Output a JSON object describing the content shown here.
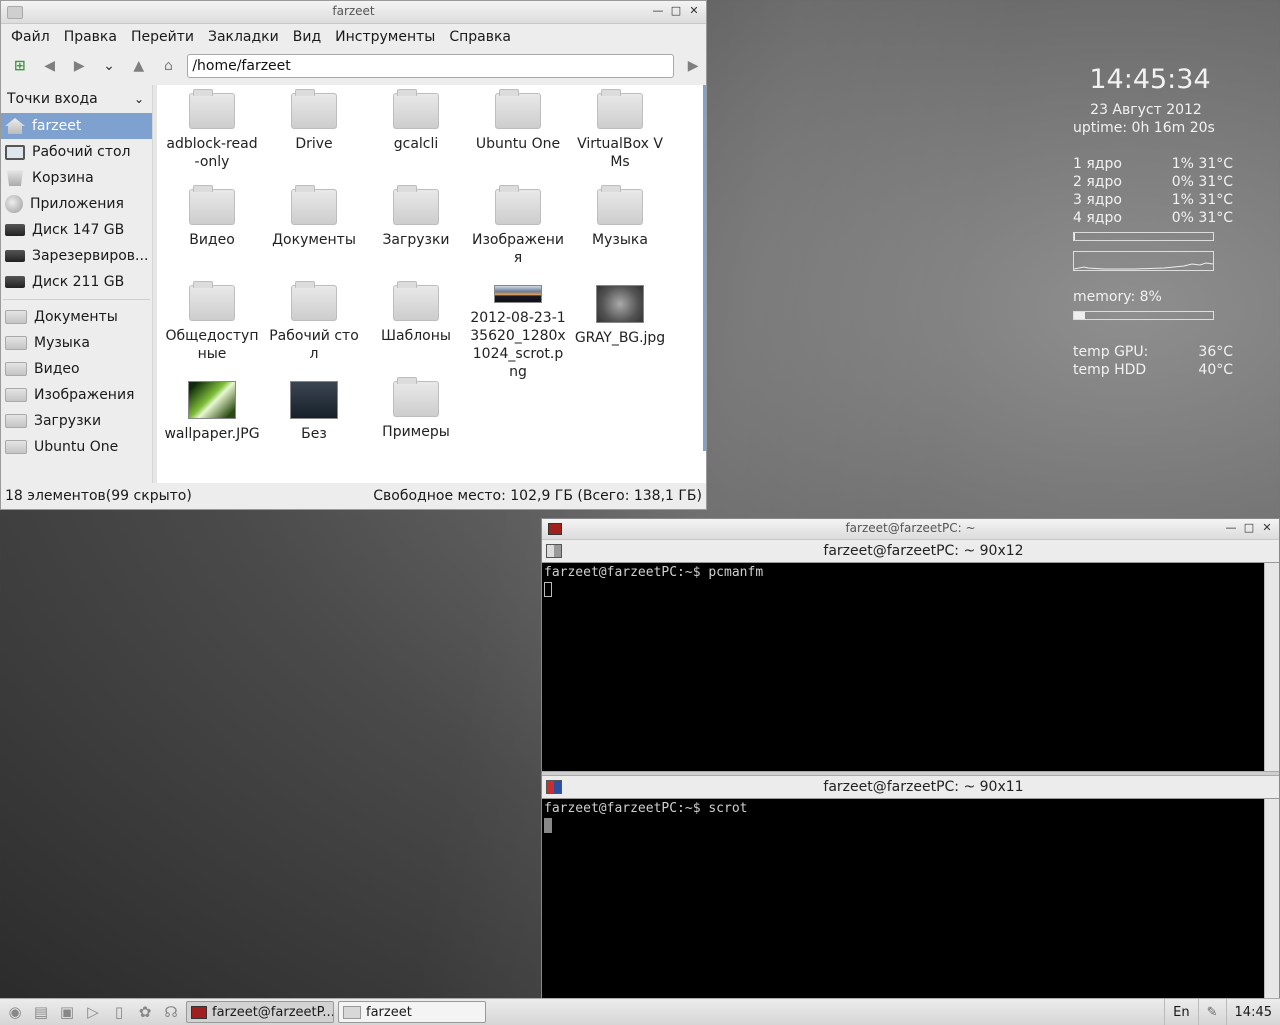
{
  "file_manager": {
    "window_title": "farzeet",
    "menu": [
      "Файл",
      "Правка",
      "Перейти",
      "Закладки",
      "Вид",
      "Инструменты",
      "Справка"
    ],
    "address": "/home/farzeet",
    "side_header": "Точки входа",
    "places": [
      {
        "label": "farzeet",
        "icon": "home-icon",
        "selected": true
      },
      {
        "label": "Рабочий стол",
        "icon": "monitor-icon"
      },
      {
        "label": "Корзина",
        "icon": "trash-icon"
      },
      {
        "label": "Приложения",
        "icon": "apps-icon"
      },
      {
        "label": "Диск 147 GB",
        "icon": "disk-icon"
      },
      {
        "label": "Зарезервиров...",
        "icon": "disk-icon"
      },
      {
        "label": "Диск 211 GB",
        "icon": "disk-icon"
      }
    ],
    "bookmarks": [
      "Документы",
      "Музыка",
      "Видео",
      "Изображения",
      "Загрузки",
      "Ubuntu One"
    ],
    "files": [
      {
        "name": "adblock-read-only",
        "type": "folder"
      },
      {
        "name": "Drive",
        "type": "folder"
      },
      {
        "name": "gcalcli",
        "type": "folder"
      },
      {
        "name": "Ubuntu One",
        "type": "folder"
      },
      {
        "name": "VirtualBox VMs",
        "type": "folder"
      },
      {
        "name": "Видео",
        "type": "folder"
      },
      {
        "name": "Документы",
        "type": "folder"
      },
      {
        "name": "Загрузки",
        "type": "folder"
      },
      {
        "name": "Изображения",
        "type": "folder"
      },
      {
        "name": "Музыка",
        "type": "folder"
      },
      {
        "name": "Общедоступные",
        "type": "folder"
      },
      {
        "name": "Рабочий стол",
        "type": "folder"
      },
      {
        "name": "Шаблоны",
        "type": "folder"
      },
      {
        "name": "2012-08-23-135620_1280x1024_scrot.png",
        "type": "image-sunset"
      },
      {
        "name": "GRAY_BG.jpg",
        "type": "image-gray"
      },
      {
        "name": "wallpaper.JPG",
        "type": "image-wall"
      },
      {
        "name": "Без",
        "type": "image-scr"
      },
      {
        "name": "Примеры",
        "type": "folder"
      }
    ],
    "status_left": "18 элементов(99 скрыто)",
    "status_right": "Свободное место: 102,9 ГБ (Всего: 138,1 ГБ)"
  },
  "conky": {
    "time": "14:45:34",
    "date": "23 Август 2012",
    "uptime": "uptime: 0h 16m 20s",
    "cores": [
      {
        "label": "1 ядро",
        "value": "1% 31°C"
      },
      {
        "label": "2 ядро",
        "value": "0% 31°C"
      },
      {
        "label": "3 ядро",
        "value": "1% 31°C"
      },
      {
        "label": "4 ядро",
        "value": "0% 31°C"
      }
    ],
    "cpu_fraction": 0.01,
    "memory": "memory: 8%",
    "memory_fraction": 0.08,
    "gpu_label": "temp GPU:",
    "gpu_value": "36°C",
    "hdd_label": "temp HDD",
    "hdd_value": "40°C"
  },
  "terminal": {
    "window_title": "farzeet@farzeetPC: ~",
    "pane1": {
      "title": "farzeet@farzeetPC: ~ 90x12",
      "line": "farzeet@farzeetPC:~$ pcmanfm"
    },
    "pane2": {
      "title": "farzeet@farzeetPC: ~ 90x11",
      "line": "farzeet@farzeetPC:~$ scrot"
    }
  },
  "panel": {
    "tasks": [
      {
        "label": "farzeet@farzeetP...",
        "active": true
      },
      {
        "label": "farzeet",
        "active": false
      }
    ],
    "lang": "En",
    "clock": "14:45"
  }
}
